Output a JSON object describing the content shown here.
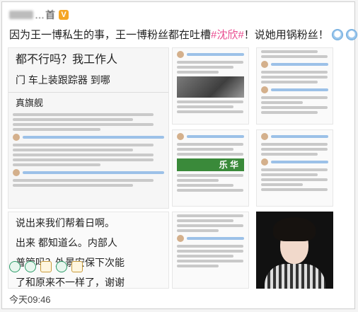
{
  "post": {
    "username": "…首",
    "verified_badge": "V",
    "text_before": "因为王一博私生的事，王一博粉丝都在吐槽",
    "hashtag": "#沈欣#",
    "text_after": "！说她用锅粉丝！",
    "emoji_icons": [
      "doge-icon",
      "doge-icon"
    ]
  },
  "big_image": {
    "line1": "都不行吗？我工作人",
    "line2": "门 车上装跟踪器 到哪",
    "line3": "真旗舰",
    "line4": "说出来我们帮着日啊。",
    "line5": "出来 都知道么。内部人",
    "line6": "普管吗？外景安保下次能",
    "line7": "了和原来不一样了，谢谢"
  },
  "thumb_texts": {
    "c2_banner": "乐 华"
  },
  "reaction_icons": [
    "share-icon",
    "comment-icon",
    "like-icon",
    "comment-icon",
    "like-icon"
  ],
  "footer": {
    "timestamp": "今天09:46"
  },
  "colors": {
    "hashtag": "#e94a8e",
    "badge": "#f5a623",
    "green_banner": "#3a8a3a"
  }
}
